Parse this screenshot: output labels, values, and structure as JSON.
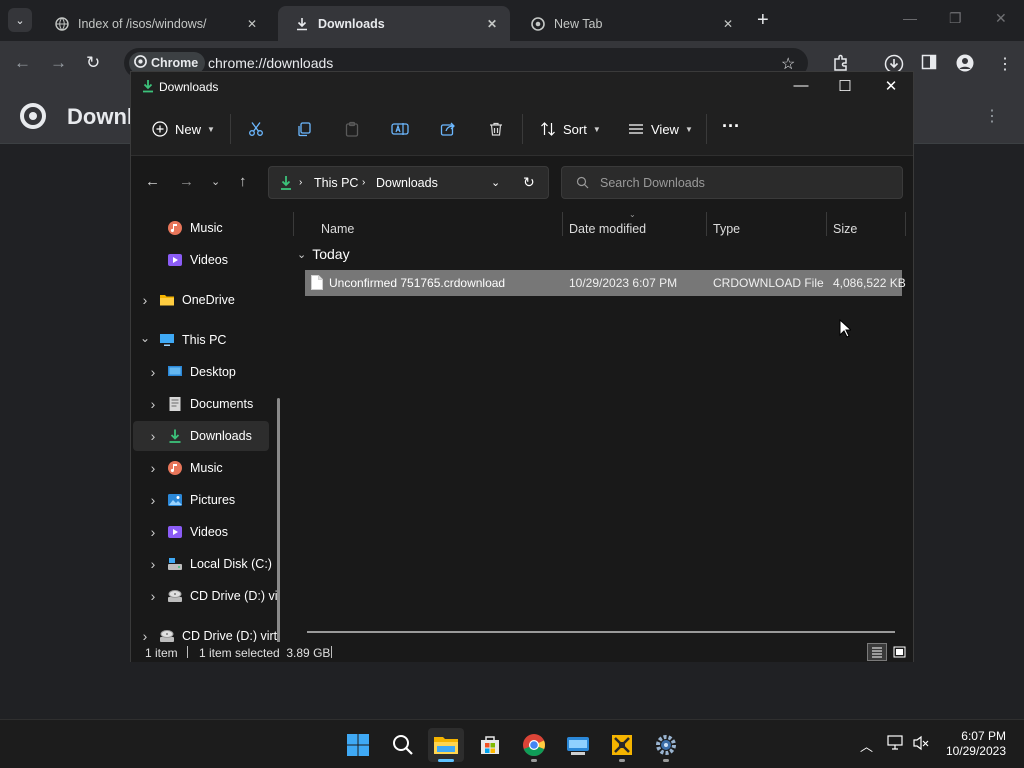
{
  "chrome": {
    "tabs": [
      {
        "title": "Index of /isos/windows/",
        "active": false,
        "icon": "globe-icon"
      },
      {
        "title": "Downloads",
        "active": true,
        "icon": "download-icon"
      },
      {
        "title": "New Tab",
        "active": false,
        "icon": "chrome-icon"
      }
    ],
    "omnibox": {
      "chip_label": "Chrome",
      "url": "chrome://downloads"
    }
  },
  "downloads_page": {
    "title_partial": "Downl"
  },
  "explorer": {
    "window_title": "Downloads",
    "commands": {
      "new": "New",
      "sort": "Sort",
      "view": "View"
    },
    "breadcrumb": [
      "This PC",
      "Downloads"
    ],
    "search_placeholder": "Search Downloads",
    "nav_items": [
      {
        "label": "Music",
        "icon": "music-icon",
        "expandable": false,
        "selected": false
      },
      {
        "label": "Videos",
        "icon": "videos-icon",
        "expandable": false,
        "selected": false
      },
      {
        "label": "OneDrive",
        "icon": "folder-icon",
        "expandable": true,
        "selected": false
      },
      {
        "label": "This PC",
        "icon": "pc-icon",
        "expandable": true,
        "expanded": true,
        "selected": false
      },
      {
        "label": "Desktop",
        "icon": "desktop-icon",
        "expandable": true,
        "selected": false
      },
      {
        "label": "Documents",
        "icon": "documents-icon",
        "expandable": true,
        "selected": false
      },
      {
        "label": "Downloads",
        "icon": "download-icon",
        "expandable": true,
        "selected": true
      },
      {
        "label": "Music",
        "icon": "music-icon",
        "expandable": true,
        "selected": false
      },
      {
        "label": "Pictures",
        "icon": "pictures-icon",
        "expandable": true,
        "selected": false
      },
      {
        "label": "Videos",
        "icon": "videos-icon",
        "expandable": true,
        "selected": false
      },
      {
        "label": "Local Disk (C:)",
        "icon": "drive-icon",
        "expandable": true,
        "selected": false
      },
      {
        "label": "CD Drive (D:) vi",
        "icon": "cd-drive-icon",
        "expandable": true,
        "selected": false
      },
      {
        "label": "CD Drive (D:) virt",
        "icon": "cd-drive-icon",
        "expandable": true,
        "selected": false
      }
    ],
    "columns": {
      "name": "Name",
      "date": "Date modified",
      "type": "Type",
      "size": "Size"
    },
    "group_label": "Today",
    "files": [
      {
        "name": "Unconfirmed 751765.crdownload",
        "date": "10/29/2023 6:07 PM",
        "type": "CRDOWNLOAD File",
        "size": "4,086,522 KB"
      }
    ],
    "status": {
      "count": "1 item",
      "selection": "1 item selected  3.89 GB"
    }
  },
  "taskbar": {
    "time": "6:07 PM",
    "date": "10/29/2023"
  }
}
